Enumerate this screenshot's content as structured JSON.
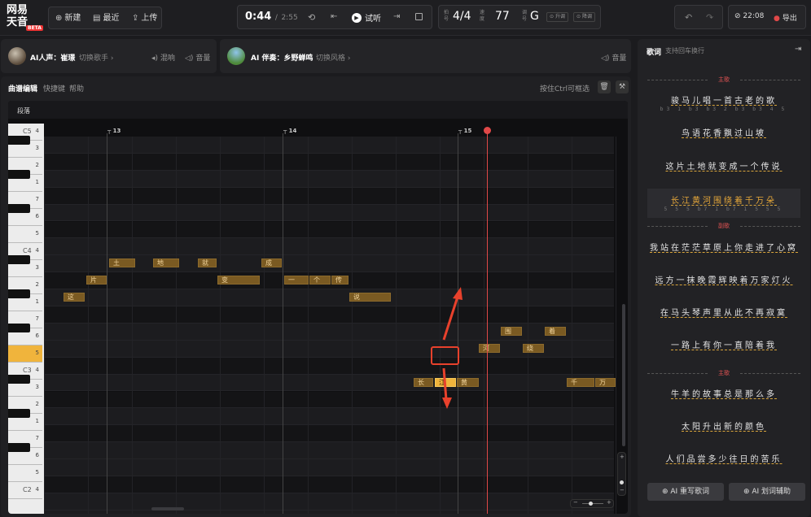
{
  "app": {
    "logo_line1": "网易",
    "logo_line2": "天音",
    "beta": "BETA"
  },
  "file_menu": {
    "new": "新建",
    "recent": "最近",
    "upload": "上传"
  },
  "transport": {
    "time_current": "0:44",
    "time_sep": "/",
    "time_total": "2:55",
    "play_label": "试听"
  },
  "song_meta": {
    "beat_label": "拍号",
    "beat": "4/4",
    "tempo_label": "速度",
    "tempo": "77",
    "key_label": "调号",
    "key": "G",
    "up_label": "升调",
    "down_label": "降调"
  },
  "right_top": {
    "clock": "22:08",
    "export": "导出"
  },
  "vocal": {
    "title": "AI人声：崔璟",
    "switch": "切换歌手",
    "mix": "混响",
    "volume": "音量"
  },
  "accomp": {
    "title": "AI 伴奏：乡野蝉鸣",
    "switch": "切换风格",
    "volume": "音量"
  },
  "editor": {
    "tab_score": "曲谱编辑",
    "tab_shortcuts": "快捷键",
    "tab_help": "帮助",
    "hint": "按住Ctrl可框选",
    "segment_label": "段落"
  },
  "ruler": {
    "bars": [
      "13",
      "14",
      "15"
    ]
  },
  "piano": {
    "octave_labels": [
      "C5",
      "C4",
      "C3",
      "C2"
    ],
    "degree_labels": [
      "4",
      "3",
      "2",
      "1",
      "7",
      "6",
      "5",
      "4",
      "3",
      "2",
      "1",
      "7",
      "6",
      "5",
      "4",
      "3",
      "2",
      "1",
      "7",
      "6",
      "5",
      "4"
    ]
  },
  "notes": [
    {
      "text": "土",
      "row": 7
    },
    {
      "text": "地",
      "row": 7
    },
    {
      "text": "就",
      "row": 7
    },
    {
      "text": "成",
      "row": 7
    },
    {
      "text": "片",
      "row": 8
    },
    {
      "text": "变",
      "row": 8
    },
    {
      "text": "一",
      "row": 8
    },
    {
      "text": "个",
      "row": 8
    },
    {
      "text": "传",
      "row": 8
    },
    {
      "text": "这",
      "row": 9
    },
    {
      "text": "说",
      "row": 9
    },
    {
      "text": "围",
      "row": 11
    },
    {
      "text": "着",
      "row": 11
    },
    {
      "text": "河",
      "row": 12
    },
    {
      "text": "绕",
      "row": 12
    },
    {
      "text": "长",
      "row": 14
    },
    {
      "text": "江",
      "row": 14
    },
    {
      "text": "黄",
      "row": 14
    },
    {
      "text": "千",
      "row": 14
    },
    {
      "text": "万",
      "row": 14
    }
  ],
  "lyrics": {
    "title": "歌词",
    "subtitle": "支持回车换行",
    "sections": {
      "verse": "主歌",
      "chorus": "副歌",
      "verse2": "主歌"
    },
    "lines": [
      {
        "text": "骏马儿唱一首古老的歌",
        "nums": "b3 1 b3 b3 2 b3 b3 4 5"
      },
      {
        "text": "鸟语花香飘过山坡",
        "nums": ""
      },
      {
        "text": "这片土地就变成一个传说",
        "nums": ""
      },
      {
        "text": "长江黄河围绕着千万朵",
        "nums": "5 5 5 b7 1 b7 1 5 5 5"
      },
      {
        "text": "我站在茫茫草原上你走进了心窝",
        "nums": ""
      },
      {
        "text": "远方一抹晚霞辉映着万家灯火",
        "nums": ""
      },
      {
        "text": "在马头琴声里从此不再寂寞",
        "nums": ""
      },
      {
        "text": "一路上有你一直陪着我",
        "nums": ""
      },
      {
        "text": "牛羊的故事总是那么多",
        "nums": ""
      },
      {
        "text": "太阳升出新的颜色",
        "nums": ""
      },
      {
        "text": "人们品尝多少往日的苦乐",
        "nums": ""
      }
    ],
    "btn_rewrite": "AI 重写歌词",
    "btn_assist": "AI 划词辅助"
  },
  "colors": {
    "accent": "#e8a93a",
    "playhead": "#e04848",
    "annotation": "#e8412c"
  }
}
